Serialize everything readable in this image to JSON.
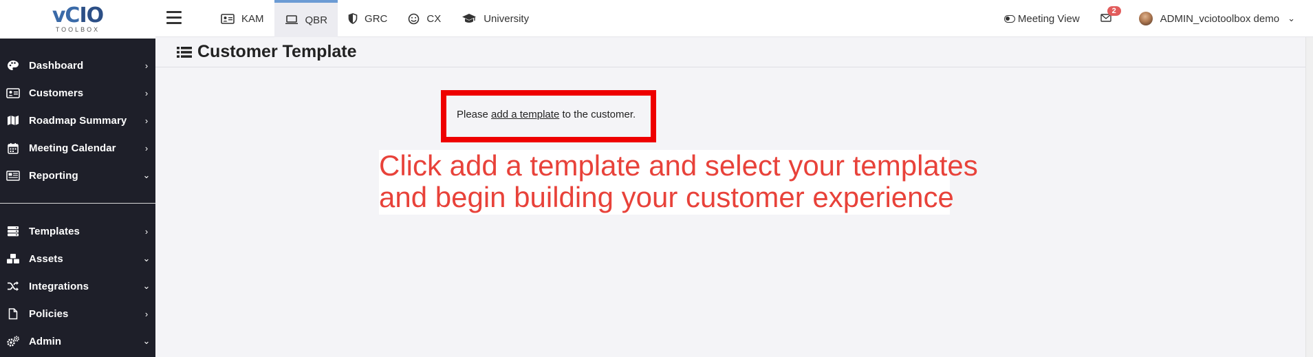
{
  "logo": {
    "main_prefix": "vC",
    "main_accent": "IO",
    "sub": "TOOLBOX"
  },
  "sidebar": {
    "items": [
      {
        "label": "Dashboard",
        "icon": "palette-icon",
        "chevron": "right"
      },
      {
        "label": "Customers",
        "icon": "address-card-icon",
        "chevron": "right"
      },
      {
        "label": "Roadmap Summary",
        "icon": "map-icon",
        "chevron": "right"
      },
      {
        "label": "Meeting Calendar",
        "icon": "calendar-icon",
        "chevron": "right"
      },
      {
        "label": "Reporting",
        "icon": "newspaper-icon",
        "chevron": "down"
      }
    ],
    "items2": [
      {
        "label": "Templates",
        "icon": "server-stack-icon",
        "chevron": "right"
      },
      {
        "label": "Assets",
        "icon": "cubes-icon",
        "chevron": "down"
      },
      {
        "label": "Integrations",
        "icon": "shuffle-icon",
        "chevron": "down"
      },
      {
        "label": "Policies",
        "icon": "file-icon",
        "chevron": "right"
      },
      {
        "label": "Admin",
        "icon": "gears-icon",
        "chevron": "down"
      }
    ]
  },
  "topbar": {
    "tabs": [
      {
        "label": "KAM",
        "icon": "id-card-icon",
        "active": false
      },
      {
        "label": "QBR",
        "icon": "laptop-icon",
        "active": true
      },
      {
        "label": "GRC",
        "icon": "shield-icon",
        "active": false
      },
      {
        "label": "CX",
        "icon": "smile-icon",
        "active": false
      },
      {
        "label": "University",
        "icon": "graduation-cap-icon",
        "active": false
      }
    ],
    "meeting_view_label": "Meeting View",
    "mail_count": "2",
    "user_name": "ADMIN_vciotoolbox demo"
  },
  "page": {
    "title": "Customer Template",
    "notice_prefix": "Please",
    "notice_link": "add a template",
    "notice_suffix": "to the customer.",
    "annotation_line1": "Click add a template and select your templates",
    "annotation_line2": "and begin building your customer experience"
  },
  "colors": {
    "sidebar_bg": "#1e1f29",
    "accent_tab": "#6b9bd4",
    "highlight_border": "#ee0000",
    "annotation_text": "#e8423a",
    "badge": "#e25c5c"
  }
}
